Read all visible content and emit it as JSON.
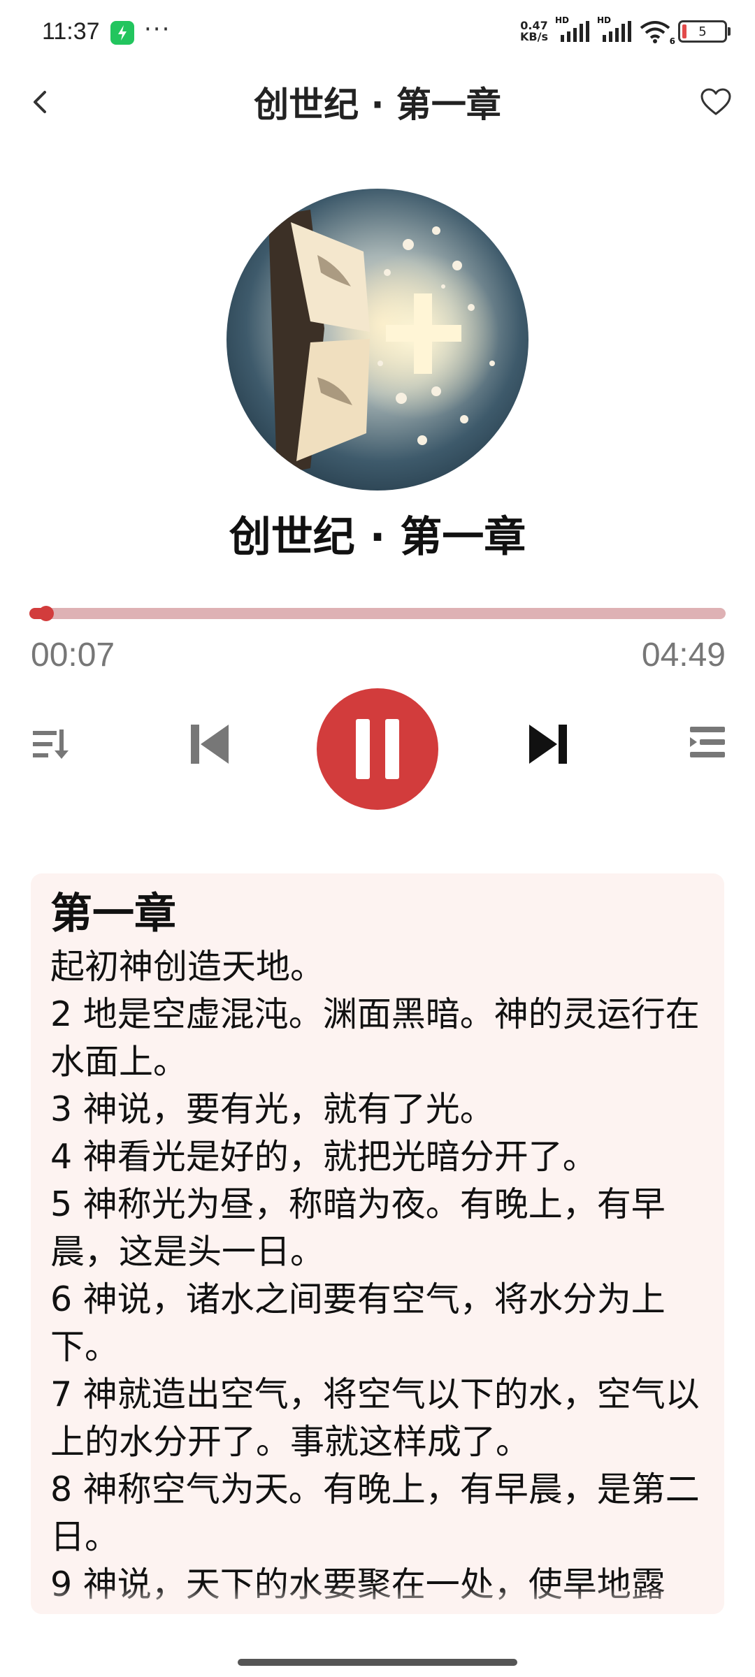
{
  "status_bar": {
    "time": "11:37",
    "dots": "···",
    "net_speed_value": "0.47",
    "net_speed_unit": "KB/s",
    "signal1_label": "HD",
    "signal2_label": "HD",
    "wifi_sub": "6",
    "battery": "5"
  },
  "header": {
    "title": "创世纪 · 第一章"
  },
  "player": {
    "track_title": "创世纪 · 第一章",
    "current_time": "00:07",
    "total_time": "04:49",
    "progress": 0.024,
    "accent_color": "#d23c3c",
    "track_color": "#deb1b4",
    "state": "playing"
  },
  "lyrics": {
    "heading": "第一章",
    "verses": [
      "起初神创造天地。",
      "2 地是空虚混沌。渊面黑暗。神的灵运行在水面上。",
      "3 神说，要有光，就有了光。",
      "4 神看光是好的，就把光暗分开了。",
      "5 神称光为昼，称暗为夜。有晚上，有早晨，这是头一日。",
      "6 神说，诸水之间要有空气，将水分为上下。",
      "7 神就造出空气，将空气以下的水，空气以上的水分开了。事就这样成了。",
      "8 神称空气为天。有晚上，有早晨，是第二日。",
      "9 神说，天下的水要聚在一处，使旱地露"
    ],
    "background_color": "#fdf3f1"
  },
  "icons": {
    "back": "chevron-left-icon",
    "favorite": "heart-outline-icon",
    "playlist": "playlist-order-icon",
    "previous": "skip-previous-icon",
    "pause": "pause-icon",
    "next": "skip-next-icon",
    "menu": "queue-menu-icon"
  }
}
